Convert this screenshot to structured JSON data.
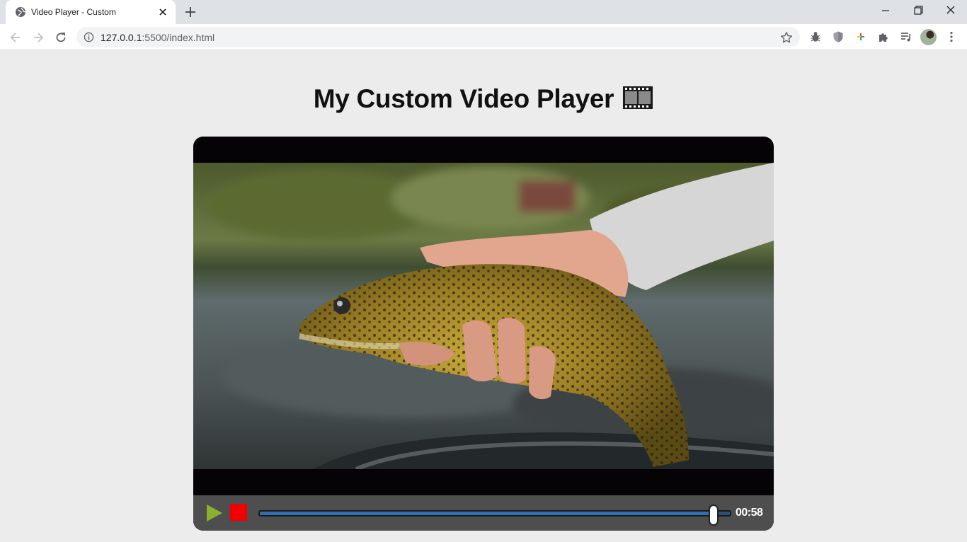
{
  "browser": {
    "tab_title": "Video Player - Custom",
    "url_host": "127.0.0.1",
    "url_rest": ":5500/index.html",
    "icons": {
      "favicon": "globe-icon",
      "close": "close-icon",
      "new_tab": "plus-icon",
      "back": "back-arrow-icon",
      "forward": "forward-arrow-icon",
      "reload": "reload-icon",
      "info": "info-icon",
      "bookmark": "star-icon",
      "extensions": [
        "bug-extension-icon",
        "shield-extension-icon",
        "plus-extension-icon",
        "puzzle-extensions-icon",
        "reading-list-icon"
      ],
      "menu": "kebab-menu-icon"
    }
  },
  "page": {
    "title": "My Custom Video Player",
    "title_icon": "film-frames-icon"
  },
  "player": {
    "play_icon": "play-icon",
    "stop_icon": "stop-icon",
    "progress": 0.965,
    "time": "00:58",
    "colors": {
      "play": "#8ab12e",
      "stop": "#f00000",
      "progress_fill": "#2f6fb5",
      "controls_bg": "#4e4e4e"
    }
  }
}
